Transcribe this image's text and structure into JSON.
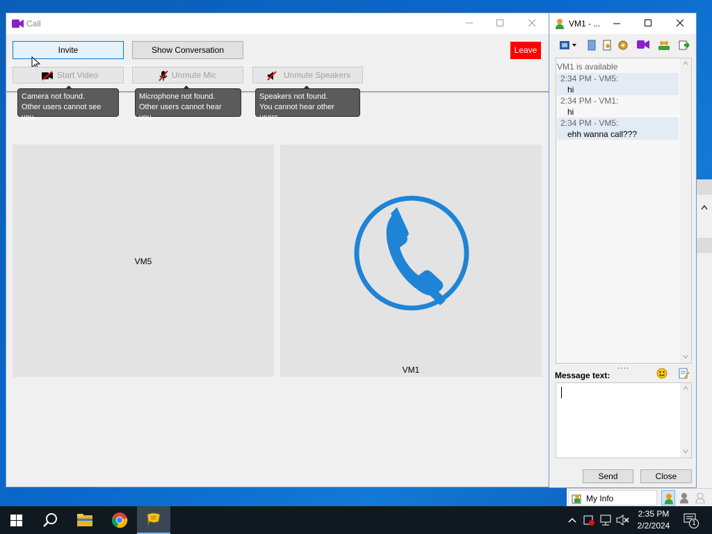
{
  "call_window": {
    "title": "Call",
    "buttons": {
      "invite": "Invite",
      "show_conversation": "Show Conversation",
      "leave": "Leave",
      "start_video": "Start Video",
      "unmute_mic": "Unmute Mic",
      "unmute_speakers": "Unmute Speakers"
    },
    "tooltips": {
      "camera_line1": "Camera not found.",
      "camera_line2": "Other users cannot see you.",
      "mic_line1": "Microphone not found.",
      "mic_line2": "Other users cannot hear you.",
      "speakers_line1": "Speakers not found.",
      "speakers_line2": "You cannot hear other users."
    },
    "participants": [
      "VM5",
      "VM1"
    ],
    "accent_color": "#1f84d6",
    "leave_color": "#ff0000"
  },
  "im_window": {
    "title": "VM1 - ...",
    "messages": [
      {
        "header": "VM1 is available",
        "body": "",
        "highlight": false
      },
      {
        "header": "2:34 PM - VM5:",
        "body": "hi",
        "highlight": true
      },
      {
        "header": "2:34 PM - VM1:",
        "body": "hi",
        "highlight": false
      },
      {
        "header": "2:34 PM - VM5:",
        "body": "ehh wanna call???",
        "highlight": true
      }
    ],
    "message_label": "Message text:",
    "message_value": "",
    "send_label": "Send",
    "close_label": "Close"
  },
  "contact_bar": {
    "my_info_label": "My Info"
  },
  "taskbar": {
    "time": "2:35 PM",
    "date": "2/2/2024",
    "notification_count": "1"
  }
}
